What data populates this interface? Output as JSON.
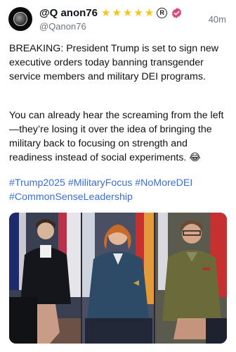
{
  "header": {
    "display_name": "@Q anon76",
    "stars": [
      "★",
      "★",
      "★",
      "★",
      "★"
    ],
    "registered_mark": "R",
    "handle": "@Qanon76",
    "timestamp": "40m"
  },
  "post": {
    "paragraph1": "BREAKING: President Trump is set to sign new executive orders today banning transgender service members and military DEI programs.",
    "paragraph2": "You can already hear the screaming from the left—they’re losing it over the idea of bringing the military back to focusing on strength and readiness instead of social experiments. 😂",
    "hashtags": [
      "#Trump2025",
      "#MilitaryFocus",
      "#NoMoreDEI",
      "#CommonSenseLeadership"
    ]
  },
  "colors": {
    "star": "#f5c518",
    "verified_badge": "#e0457b",
    "hashtag": "#3b6fd4",
    "muted": "#6e767d"
  },
  "icons": {
    "avatar": "q-logo-avatar",
    "verified": "verified-badge-icon"
  }
}
